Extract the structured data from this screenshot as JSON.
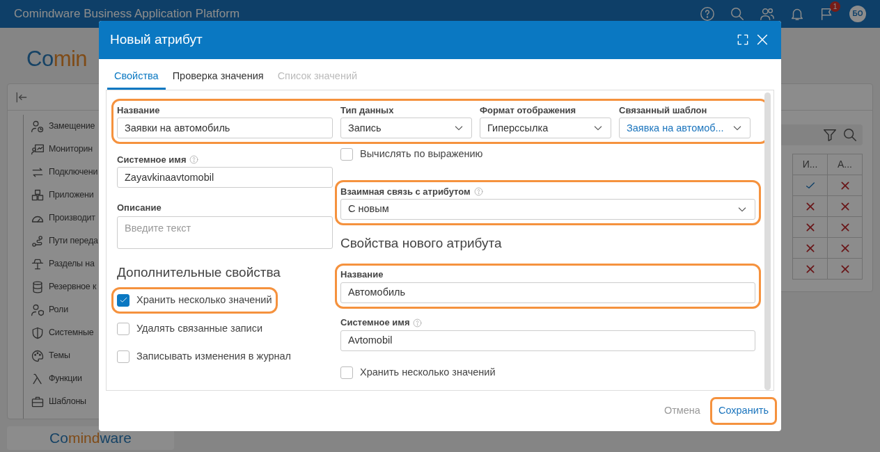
{
  "app": {
    "title": "Comindware Business Application Platform",
    "notifications": "1",
    "avatar": "БО"
  },
  "logo": {
    "parts": [
      "Co",
      "min"
    ]
  },
  "sidebar": {
    "items": [
      {
        "label": "Замещение"
      },
      {
        "label": "Мониторин"
      },
      {
        "label": "Подключени"
      },
      {
        "label": "Приложени"
      },
      {
        "label": "Производит"
      },
      {
        "label": "Пути переда"
      },
      {
        "label": "Разделы на"
      },
      {
        "label": "Резервное к"
      },
      {
        "label": "Роли"
      },
      {
        "label": "Системные"
      },
      {
        "label": "Темы"
      },
      {
        "label": "Функции"
      },
      {
        "label": "Шаблоны"
      }
    ]
  },
  "footer_logo": {
    "parts": [
      "Co",
      "mind",
      "ware"
    ]
  },
  "table": {
    "columns": [
      "И...",
      "А..."
    ],
    "rows": [
      {
        "cells": [
          {
            "checked": true
          },
          {
            "checked": false
          }
        ]
      },
      {
        "cells": [
          {
            "checked": false
          },
          {
            "checked": false
          }
        ]
      },
      {
        "cells": [
          {
            "checked": false
          },
          {
            "checked": false
          }
        ]
      },
      {
        "cells": [
          {
            "checked": false
          },
          {
            "checked": false
          }
        ]
      },
      {
        "cells": [
          {
            "checked": false
          },
          {
            "checked": false
          }
        ]
      }
    ]
  },
  "dialog": {
    "title": "Новый атрибут",
    "tabs": [
      {
        "label": "Свойства",
        "selected": true,
        "disabled": false
      },
      {
        "label": "Проверка значения",
        "selected": false,
        "disabled": false
      },
      {
        "label": "Список значений",
        "selected": false,
        "disabled": true
      }
    ],
    "top_row": {
      "highlighted": true,
      "name": {
        "label": "Название",
        "value": "Заявки на автомобиль"
      },
      "selects": [
        {
          "label": "Тип данных",
          "value": "Запись",
          "linked": false
        },
        {
          "label": "Формат отображения",
          "value": "Гиперссылка",
          "linked": false
        },
        {
          "label": "Связанный шаблон",
          "value": "Заявка на автомоб...",
          "linked": true
        }
      ]
    },
    "system_name": {
      "label": "Системное имя",
      "value": "Zayavkinaavtomobil"
    },
    "description": {
      "label": "Описание",
      "placeholder": "Введите текст"
    },
    "additional": {
      "heading": "Дополнительные свойства",
      "options": [
        {
          "label": "Хранить несколько значений",
          "checked": true,
          "highlighted": true
        },
        {
          "label": "Удалять связанные записи",
          "checked": false
        },
        {
          "label": "Записывать изменения в журнал",
          "checked": false
        }
      ]
    },
    "compute": {
      "label": "Вычислять по выражению",
      "checked": false
    },
    "relation": {
      "label": "Взаимная связь с атрибутом",
      "value": "С новым",
      "highlighted": true
    },
    "new_heading": "Свойства нового атрибута",
    "new_name": {
      "label": "Название",
      "value": "Автомобиль",
      "highlighted": true
    },
    "new_system_name": {
      "label": "Системное имя",
      "value": "Avtomobil"
    },
    "new_multiple": {
      "label": "Хранить несколько значений",
      "checked": false
    },
    "buttons": [
      {
        "label": "Отмена",
        "kind": "secondary",
        "highlighted": false
      },
      {
        "label": "Сохранить",
        "kind": "primary",
        "highlighted": true
      }
    ]
  }
}
